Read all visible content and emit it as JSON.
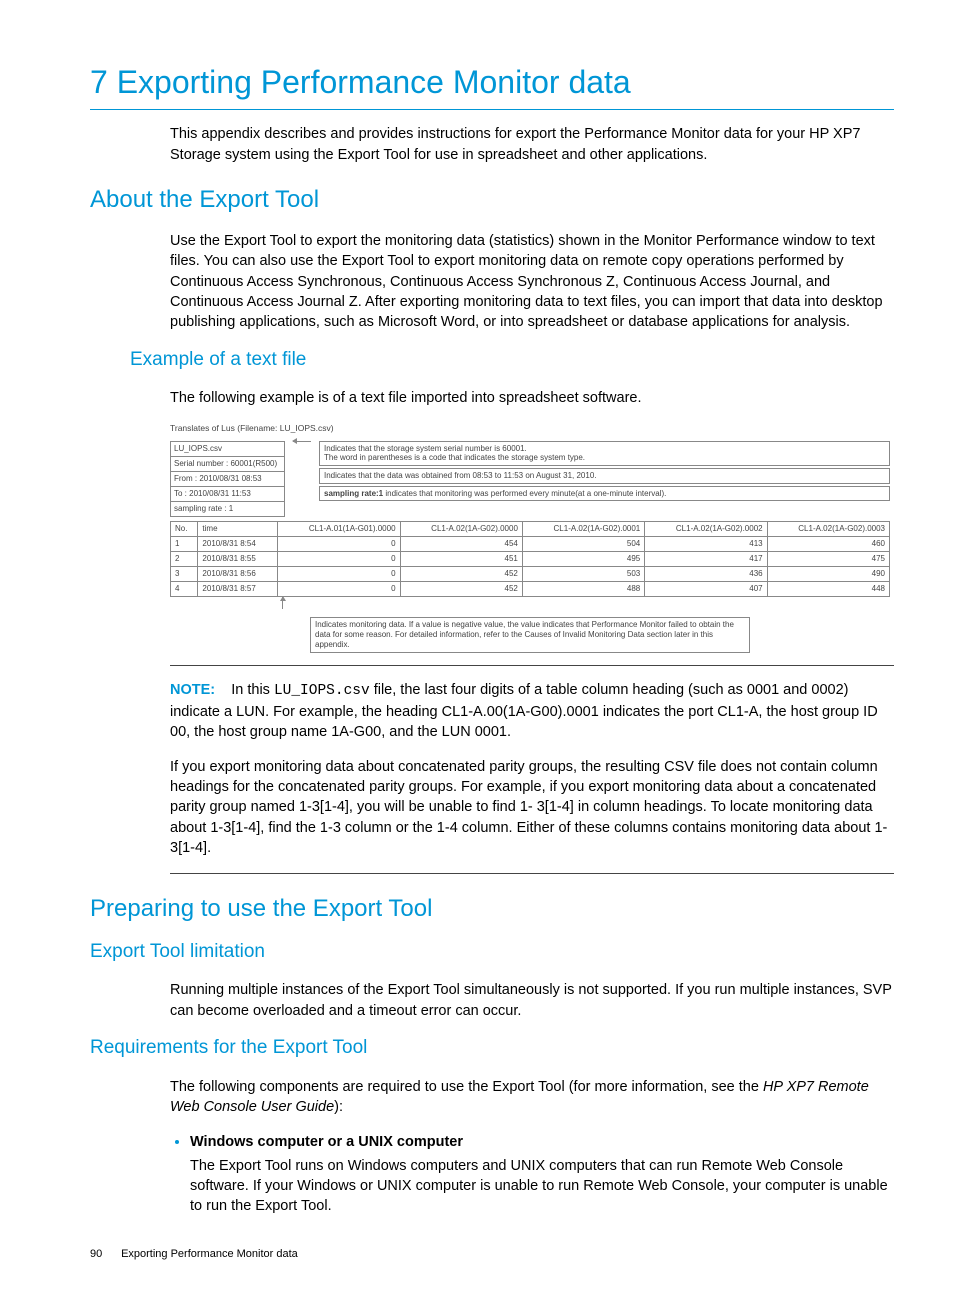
{
  "h1": "7 Exporting Performance Monitor data",
  "intro": "This appendix describes and provides instructions for export the Performance Monitor data for your HP XP7 Storage system using the Export Tool for use in spreadsheet and other applications.",
  "about": {
    "h2": "About the Export Tool",
    "p": "Use the Export Tool to export the monitoring data (statistics) shown in the Monitor Performance window to text files. You can also use the Export Tool to export monitoring data on remote copy operations performed by Continuous Access Synchronous, Continuous Access Synchronous Z, Continuous Access Journal, and Continuous Access Journal Z. After exporting monitoring data to text files, you can import that data into desktop publishing applications, such as Microsoft Word, or into spreadsheet or database applications for analysis.",
    "example_h3": "Example of a text file",
    "example_p": "The following example is of a text file imported into spreadsheet software."
  },
  "figure": {
    "caption": "Translates of Lus (Filename: LU_IOPS.csv)",
    "left_rows": [
      "LU_IOPS.csv",
      "Serial number : 60001(R500)",
      "From : 2010/08/31 08:53",
      "To : 2010/08/31 11:53",
      "sampling rate : 1"
    ],
    "callout1": "Indicates that the storage system serial number is 60001.\nThe word in parentheses is a code that indicates the storage system type.",
    "callout2": "Indicates that the data was obtained from 08:53 to 11:53 on August 31, 2010.",
    "callout3_prefix": "sampling rate:1",
    "callout3_rest": " indicates that monitoring was performed every minute(at a one-minute interval).",
    "columns": [
      "No.",
      "time",
      "CL1-A.01(1A-G01).0000",
      "CL1-A.02(1A-G02).0000",
      "CL1-A.02(1A-G02).0001",
      "CL1-A.02(1A-G02).0002",
      "CL1-A.02(1A-G02).0003"
    ],
    "rows": [
      [
        "1",
        "2010/8/31 8:54",
        "0",
        "454",
        "504",
        "413",
        "460"
      ],
      [
        "2",
        "2010/8/31 8:55",
        "0",
        "451",
        "495",
        "417",
        "475"
      ],
      [
        "3",
        "2010/8/31 8:56",
        "0",
        "452",
        "503",
        "436",
        "490"
      ],
      [
        "4",
        "2010/8/31 8:57",
        "0",
        "452",
        "488",
        "407",
        "448"
      ]
    ],
    "bottom_note": "Indicates monitoring data. If a value is negative value, the value indicates that Performance Monitor failed to obtain the data for some reason. For detailed information, refer to the Causes of Invalid Monitoring Data section later in this appendix."
  },
  "note": {
    "label": "NOTE:",
    "text_before": "In this ",
    "code": "LU_IOPS.csv",
    "text_after": " file, the last four digits of a table column heading (such as 0001 and 0002) indicate a LUN. For example, the heading CL1-A.00(1A-G00).0001 indicates the port CL1-A, the host group ID 00, the host group name 1A-G00, and the LUN 0001."
  },
  "note2": "If you export monitoring data about concatenated parity groups, the resulting CSV file does not contain column headings for the concatenated parity groups. For example, if you export monitoring data about a concatenated parity group named 1-3[1-4], you will be unable to find 1- 3[1-4] in column headings. To locate monitoring data about 1-3[1-4], find the 1-3 column or the 1-4 column. Either of these columns contains monitoring data about 1-3[1-4].",
  "prep": {
    "h2": "Preparing to use the Export Tool",
    "lim_h3": "Export Tool limitation",
    "lim_p": "Running multiple instances of the Export Tool simultaneously is not supported. If you run multiple instances, SVP can become overloaded and a timeout error can occur.",
    "req_h3": "Requirements for the Export Tool",
    "req_p_before": "The following components are required to use the Export Tool (for more information, see the ",
    "req_p_italic": "HP XP7 Remote Web Console User Guide",
    "req_p_after": "):",
    "bullet_title": "Windows computer or a UNIX computer",
    "bullet_body": "The Export Tool runs on Windows computers and UNIX computers that can run Remote Web Console software. If your Windows or UNIX computer is unable to run Remote Web Console, your computer is unable to run the Export Tool."
  },
  "footer": {
    "page": "90",
    "label": "Exporting Performance Monitor data"
  }
}
